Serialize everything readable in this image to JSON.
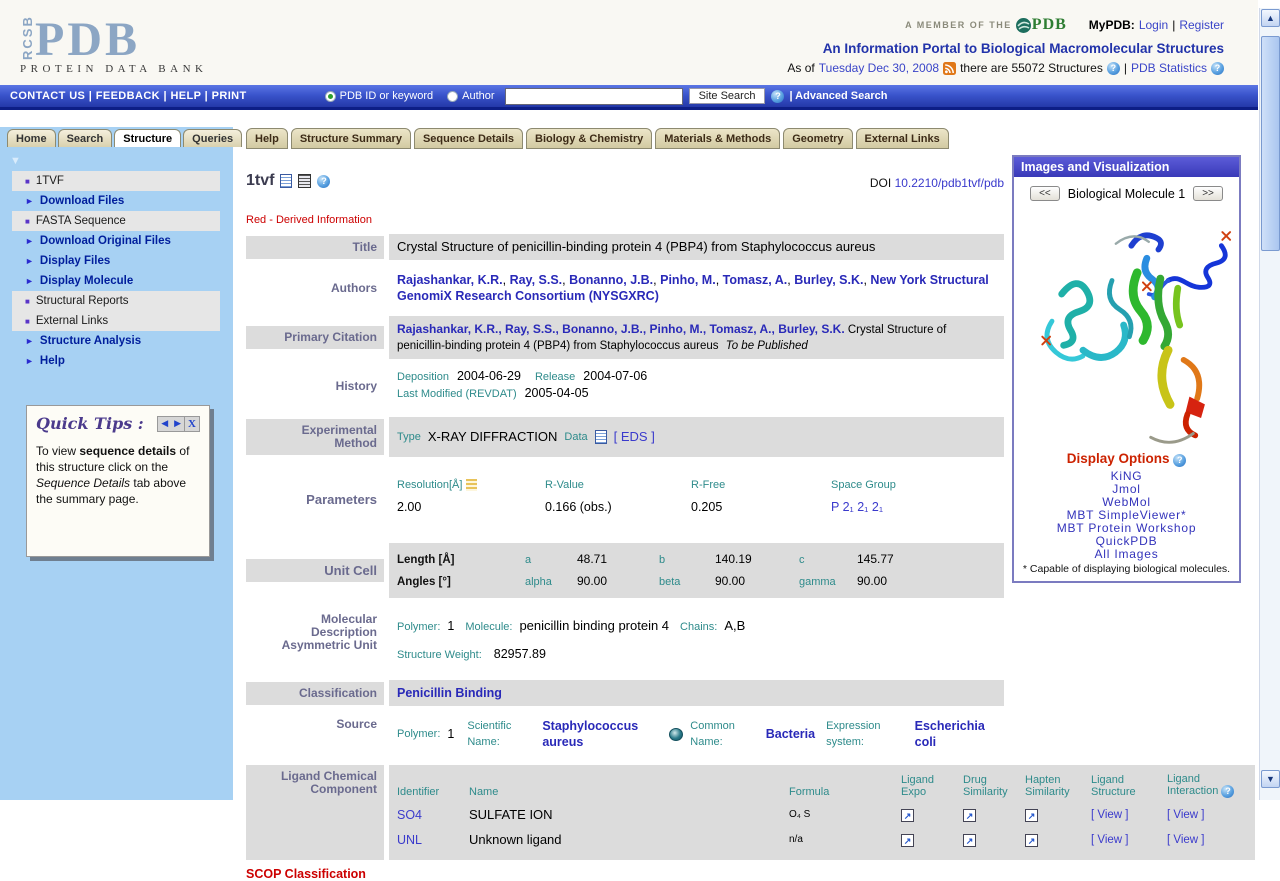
{
  "colors": {
    "navbar_blue": "#3a54cc",
    "sidebar_blue": "#a7d1f3",
    "row_gray": "#dcdcdc",
    "link_blue": "#3a3acc",
    "teal": "#2e8b8b",
    "label_slate": "#6a6a8e",
    "alert_red": "#cc0000"
  },
  "icons": {
    "help_glyph": "?",
    "square_bullet": "■",
    "arrow_bullet": "►",
    "triangle_down": "▼",
    "ext_link_glyph": "↗",
    "prev_tip": "◀",
    "next_tip": "▶",
    "close_tip": "X"
  },
  "header": {
    "logo_rcsb": "RCSB",
    "logo_pdb": "PDB",
    "logo_sub": "PROTEIN DATA BANK",
    "member_prefix": "A MEMBER OF THE",
    "wwpdb": "PDB",
    "mypdb_label": "MyPDB:",
    "login": "Login",
    "sep": "|",
    "register": "Register",
    "tagline": "An Information Portal to Biological Macromolecular Structures",
    "asof_prefix": "As of",
    "asof_date": "Tuesday Dec 30, 2008",
    "asof_count": "there are 55072 Structures",
    "stats": "PDB Statistics"
  },
  "navbar": {
    "links": [
      {
        "label": "CONTACT US"
      },
      {
        "label": "FEEDBACK"
      },
      {
        "label": "HELP"
      },
      {
        "label": "PRINT"
      }
    ],
    "sep": "|",
    "radio1": "PDB ID or keyword",
    "radio2": "Author",
    "search_button": "Site Search",
    "advanced": "| Advanced Search"
  },
  "sidebar": {
    "tabs": [
      {
        "label": "Home"
      },
      {
        "label": "Search"
      },
      {
        "label": "Structure"
      },
      {
        "label": "Queries"
      }
    ],
    "menu": [
      {
        "label": "1TVF"
      },
      {
        "label": "Download Files"
      },
      {
        "label": "FASTA Sequence"
      },
      {
        "label": "Download Original Files"
      },
      {
        "label": "Display Files"
      },
      {
        "label": "Display Molecule"
      },
      {
        "label": "Structural Reports"
      },
      {
        "label": "External Links"
      },
      {
        "label": "Structure Analysis"
      },
      {
        "label": "Help"
      }
    ],
    "quicktips": {
      "title": "Quick Tips :",
      "tip_1": "To view ",
      "tip_bold": "sequence details",
      "tip_2": " of this structure click on the ",
      "tip_italic": "Sequence Details",
      "tip_3": " tab above the summary page."
    }
  },
  "content": {
    "tabs": [
      {
        "label": "Help"
      },
      {
        "label": "Structure Summary"
      },
      {
        "label": "Sequence Details"
      },
      {
        "label": "Biology & Chemistry"
      },
      {
        "label": "Materials & Methods"
      },
      {
        "label": "Geometry"
      },
      {
        "label": "External Links"
      }
    ],
    "pdb_id": "1tvf",
    "doi_label": "DOI",
    "doi_value": "10.2210/pdb1tvf/pdb",
    "derived_note": "Red - Derived Information",
    "title_label": "Title",
    "title_value": "Crystal Structure of penicillin-binding protein 4 (PBP4) from Staphylococcus aureus",
    "authors_label": "Authors",
    "comma": ",",
    "authors": [
      {
        "name": "Rajashankar, K.R."
      },
      {
        "name": "Ray, S.S."
      },
      {
        "name": "Bonanno, J.B."
      },
      {
        "name": "Pinho, M."
      },
      {
        "name": "Tomasz, A."
      },
      {
        "name": "Burley, S.K."
      },
      {
        "name": "New York Structural GenomiX Research Consortium (NYSGXRC)"
      }
    ],
    "citation_label": "Primary Citation",
    "citation_authors": "Rajashankar, K.R., Ray, S.S., Bonanno, J.B., Pinho, M., Tomasz, A., Burley, S.K.",
    "citation_text": "Crystal Structure of penicillin-binding protein 4 (PBP4) from Staphylococcus aureus",
    "citation_status": "To be Published",
    "history_label": "History",
    "history": {
      "dep_label": "Deposition",
      "dep": "2004-06-29",
      "rel_label": "Release",
      "rel": "2004-07-06",
      "mod_label": "Last Modified (REVDAT)",
      "mod": "2005-04-05"
    },
    "expmethod_label_1": "Experimental",
    "expmethod_label_2": "Method",
    "expmethod": {
      "type_label": "Type",
      "type": "X-RAY DIFFRACTION",
      "data_label": "Data",
      "eds": "[ EDS ]"
    },
    "params_label": "Parameters",
    "params": {
      "res_label": "Resolution[Å]",
      "res": "2.00",
      "rv_label": "R-Value",
      "rv": "0.166 (obs.)",
      "rf_label": "R-Free",
      "rf": "0.205",
      "sg_label": "Space Group",
      "sg": "P 2₁ 2₁ 2₁"
    },
    "unitcell_label": "Unit Cell",
    "unitcell": {
      "len_label": "Length [Å]",
      "ang_label": "Angles [°]",
      "a_l": "a",
      "a": "48.71",
      "b_l": "b",
      "b": "140.19",
      "c_l": "c",
      "c": "145.77",
      "al_l": "alpha",
      "al": "90.00",
      "be_l": "beta",
      "be": "90.00",
      "ga_l": "gamma",
      "ga": "90.00"
    },
    "moldesc_label_1": "Molecular",
    "moldesc_label_2": "Description",
    "moldesc_label_3": "Asymmetric Unit",
    "moldesc": {
      "poly_label": "Polymer:",
      "poly": "1",
      "mol_label": "Molecule:",
      "mol": "penicillin binding protein 4",
      "chains_label": "Chains:",
      "chains": "A,B",
      "weight_label": "Structure Weight:",
      "weight": "82957.89"
    },
    "class_label": "Classification",
    "class_value": "Penicillin Binding",
    "source_label": "Source",
    "source": {
      "poly_label": "Polymer:",
      "poly": "1",
      "sci_label": "Scientific Name:",
      "sci": "Staphylococcus aureus",
      "common_label": "Common Name:",
      "common": "Bacteria",
      "expr_label": "Expression system:",
      "expr": "Escherichia coli"
    },
    "ligand_label_1": "Ligand Chemical",
    "ligand_label_2": "Component",
    "ligand": {
      "headers": {
        "id": "Identifier",
        "name": "Name",
        "formula": "Formula",
        "expo_1": "Ligand",
        "expo_2": "Expo",
        "drug_1": "Drug",
        "drug_2": "Similarity",
        "hapten_1": "Hapten",
        "hapten_2": "Similarity",
        "struct_1": "Ligand",
        "struct_2": "Structure",
        "inter_1": "Ligand",
        "inter_2": "Interaction"
      },
      "rows": [
        {
          "id": "SO4",
          "name": "SULFATE ION",
          "formula": "O₄ S",
          "view": "[ View ]"
        },
        {
          "id": "UNL",
          "name": "Unknown ligand",
          "formula": "n/a",
          "view": "[ View ]"
        }
      ]
    },
    "scop_label": "SCOP Classification"
  },
  "right_panel": {
    "title": "Images and Visualization",
    "prev": "<<",
    "next": ">>",
    "molecule": "Biological Molecule 1",
    "display_options": "Display Options",
    "viewers": [
      {
        "label": "KiNG"
      },
      {
        "label": "Jmol"
      },
      {
        "label": "WebMol"
      },
      {
        "label": "MBT SimpleViewer*"
      },
      {
        "label": "MBT Protein Workshop"
      },
      {
        "label": "QuickPDB"
      },
      {
        "label": "All Images"
      }
    ],
    "footnote": "* Capable of displaying biological molecules."
  }
}
